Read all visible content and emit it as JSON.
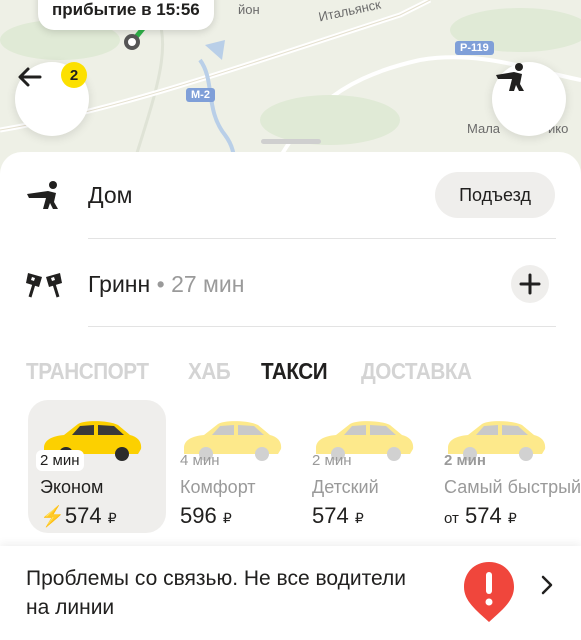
{
  "map": {
    "tooltip": "прибытие в 15:56",
    "labels": [
      "Итальянск",
      "йон",
      "Мала",
      "ико"
    ],
    "road_badges": [
      "Р-119",
      "М-2"
    ],
    "back_badge_count": "2",
    "back_icon": "arrow-left-icon",
    "pedestrian_icon": "pedestrian-pointing-icon"
  },
  "route": {
    "from": {
      "label": "Дом",
      "action": "Подъезд",
      "icon": "pedestrian-pointing-icon"
    },
    "to": {
      "label": "Гринн",
      "separator": "•",
      "duration": "27 мин",
      "action_icon": "plus-icon",
      "icon": "checkered-flags-icon"
    }
  },
  "tabs": [
    {
      "label": "ТРАНСПОРТ",
      "active": false
    },
    {
      "label": "ХАБ",
      "active": false
    },
    {
      "label": "ТАКСИ",
      "active": true
    },
    {
      "label": "ДОСТАВКА",
      "active": false
    }
  ],
  "tariffs": [
    {
      "eta": "2 мин",
      "name": "Эконом",
      "price": "574",
      "currency": "₽",
      "prefix": "",
      "surge_icon": "lightning-icon",
      "selected": true
    },
    {
      "eta": "4 мин",
      "name": "Комфорт",
      "price": "596",
      "currency": "₽",
      "prefix": "",
      "selected": false
    },
    {
      "eta": "2 мин",
      "name": "Детский",
      "price": "574",
      "currency": "₽",
      "prefix": "",
      "selected": false
    },
    {
      "eta": "2 мин",
      "name": "Самый быстрый",
      "price": "574",
      "currency": "₽",
      "prefix": "от",
      "selected": false,
      "eta_highlight": true
    }
  ],
  "banner": {
    "text": "Проблемы со связью. Не все водители на линии",
    "icon": "alert-icon",
    "chevron_icon": "chevron-right-icon"
  },
  "colors": {
    "accent": "#fce000",
    "green": "#2fb34a",
    "alert": "#f0463c",
    "surge": "#ff8a00"
  }
}
